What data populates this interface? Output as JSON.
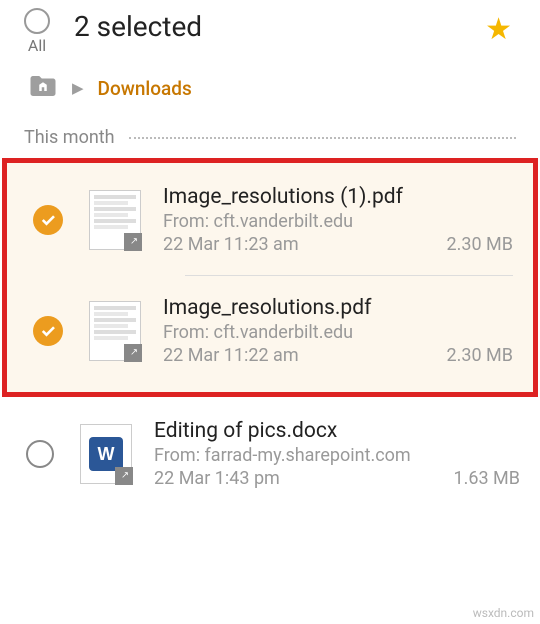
{
  "header": {
    "all_label": "All",
    "selected_text": "2 selected"
  },
  "breadcrumb": {
    "link": "Downloads"
  },
  "section": {
    "title": "This month"
  },
  "files": [
    {
      "name": "Image_resolutions (1).pdf",
      "source": "From: cft.vanderbilt.edu",
      "date": "22 Mar 11:23 am",
      "size": "2.30 MB"
    },
    {
      "name": "Image_resolutions.pdf",
      "source": "From: cft.vanderbilt.edu",
      "date": "22 Mar 11:22 am",
      "size": "2.30 MB"
    },
    {
      "name": "Editing of pics.docx",
      "source": "From: farrad-my.sharepoint.com",
      "date": "22 Mar 1:43 pm",
      "size": "1.63 MB"
    }
  ],
  "watermark": "wsxdn.com"
}
